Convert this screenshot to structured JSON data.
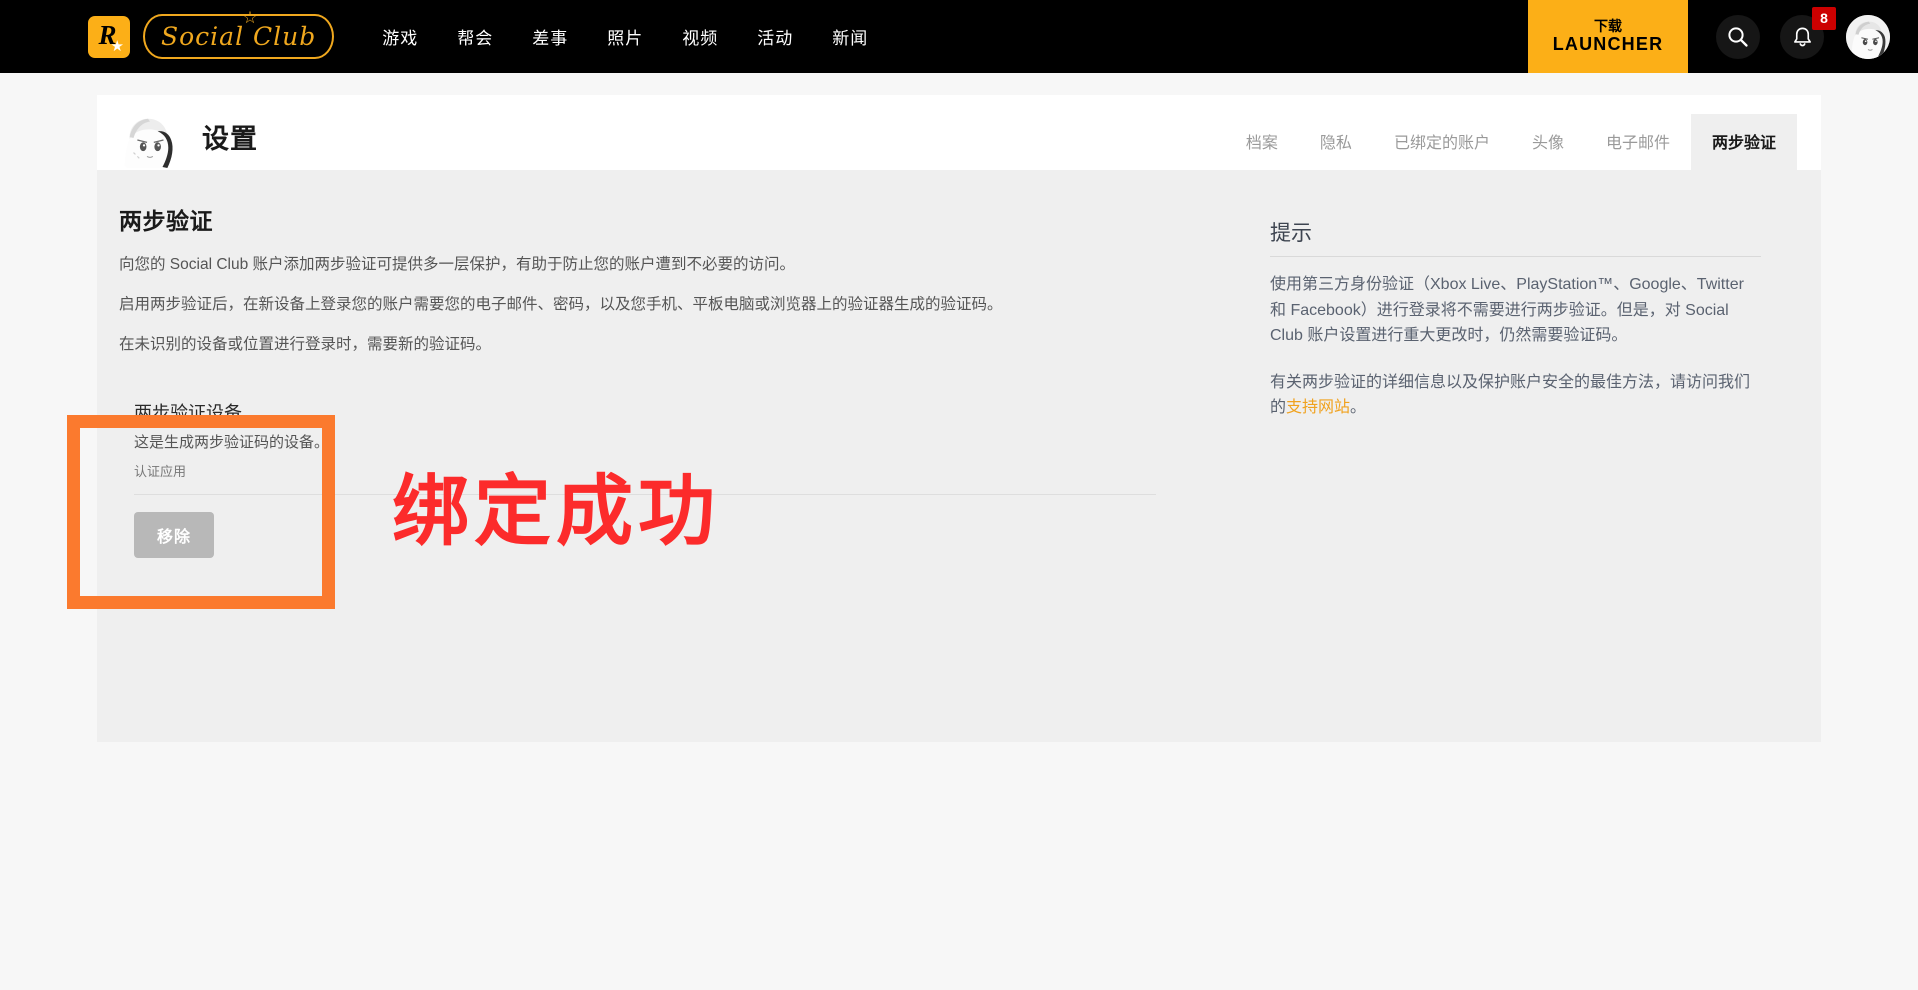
{
  "topbar": {
    "logo_r": "R",
    "logo_wordmark": "Social Club",
    "nav_items": [
      {
        "label": "游戏"
      },
      {
        "label": "帮会"
      },
      {
        "label": "差事"
      },
      {
        "label": "照片"
      },
      {
        "label": "视频"
      },
      {
        "label": "活动"
      },
      {
        "label": "新闻"
      }
    ],
    "launcher": {
      "line1": "下载",
      "line2": "LAUNCHER"
    },
    "search_icon": "search-icon",
    "bell_icon": "bell-icon",
    "notification_count": "8",
    "avatar": "user-avatar"
  },
  "header": {
    "title": "设置"
  },
  "tabs": [
    {
      "label": "档案",
      "active": false
    },
    {
      "label": "隐私",
      "active": false
    },
    {
      "label": "已绑定的账户",
      "active": false
    },
    {
      "label": "头像",
      "active": false
    },
    {
      "label": "电子邮件",
      "active": false
    },
    {
      "label": "两步验证",
      "active": true
    }
  ],
  "main": {
    "section_title": "两步验证",
    "paragraphs": [
      "向您的 Social Club 账户添加两步验证可提供多一层保护，有助于防止您的账户遭到不必要的访问。",
      "启用两步验证后，在新设备上登录您的账户需要您的电子邮件、密码，以及您手机、平板电脑或浏览器上的验证器生成的验证码。",
      "在未识别的设备或位置进行登录时，需要新的验证码。"
    ],
    "device_card": {
      "title": "两步验证设备",
      "subtitle": "这是生成两步验证码的设备。",
      "app_name": "认证应用",
      "remove_button": "移除"
    },
    "overlay_stamp": "绑定成功"
  },
  "tips": {
    "title": "提示",
    "paragraph1": "使用第三方身份验证（Xbox Live、PlayStation™、Google、Twitter 和 Facebook）进行登录将不需要进行两步验证。但是，对 Social Club 账户设置进行重大更改时，仍然需要验证码。",
    "paragraph2_pre": "有关两步验证的详细信息以及保护账户安全的最佳方法，请访问我们的",
    "paragraph2_link": "支持网站",
    "paragraph2_post": "。"
  },
  "colors": {
    "brand_yellow": "#fcaf17",
    "link_orange": "#f0a21e",
    "highlight_orange": "#fb7a2e",
    "stamp_red": "#fc2b2b",
    "badge_red": "#cc0000",
    "panel_bg": "#efefef",
    "page_bg": "#f7f7f7"
  }
}
